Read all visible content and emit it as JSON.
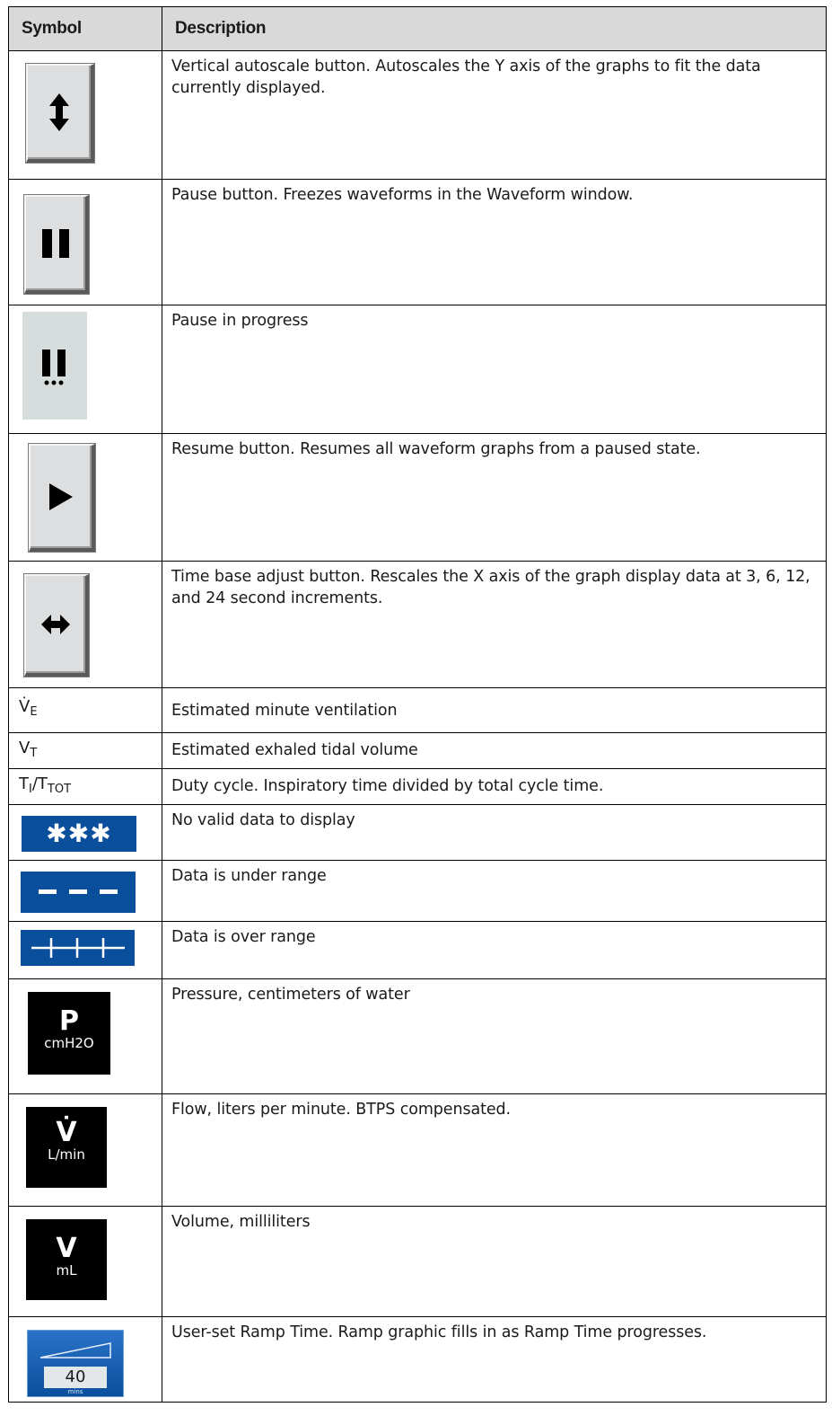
{
  "header": {
    "symbol": "Symbol",
    "description": "Description"
  },
  "rows": [
    {
      "symbol_icon": "vertical-autoscale-icon",
      "description": "Vertical autoscale button. Autoscales the Y axis of the graphs to fit the data currently displayed."
    },
    {
      "symbol_icon": "pause-icon",
      "description": "Pause button. Freezes waveforms in the Waveform window."
    },
    {
      "symbol_icon": "pause-in-progress-icon",
      "description": "Pause in progress"
    },
    {
      "symbol_icon": "resume-play-icon",
      "description": "Resume button. Resumes all waveform graphs from a paused state."
    },
    {
      "symbol_icon": "time-base-adjust-icon",
      "description": "Time base adjust button. Rescales the X axis of the graph display data at 3, 6, 12, and 24 second increments."
    },
    {
      "symbol_text": {
        "main": "V̇",
        "sub": "E"
      },
      "description": "Estimated minute ventilation"
    },
    {
      "symbol_text": {
        "main": "V",
        "sub": "T"
      },
      "description": "Estimated exhaled tidal volume"
    },
    {
      "symbol_text": {
        "main1": "T",
        "sub1": "I",
        "slash": "/T",
        "sub2": "TOT"
      },
      "description": "Duty cycle. Inspiratory time divided by total cycle time."
    },
    {
      "symbol_glyph": "✱✱✱",
      "description": "No valid data to display"
    },
    {
      "symbol_glyph": "---",
      "description": "Data is under range"
    },
    {
      "symbol_glyph": "+++",
      "description": "Data is over range"
    },
    {
      "symbol_label": {
        "big": "P",
        "unit": "cmH2O"
      },
      "description": "Pressure, centimeters of water"
    },
    {
      "symbol_label": {
        "big": "V̇",
        "unit": "L/min"
      },
      "description": "Flow, liters per minute. BTPS compensated."
    },
    {
      "symbol_label": {
        "big": "V",
        "unit": "mL"
      },
      "description": "Volume, milliliters"
    },
    {
      "symbol_ramp": {
        "value": "40",
        "unit": "mins"
      },
      "description": "User-set Ramp Time. Ramp graphic fills in as Ramp Time progresses."
    }
  ],
  "colors": {
    "header_bg": "#d9d9d9",
    "status_blue": "#0a4f9c",
    "button_face": "#dcdedf"
  }
}
